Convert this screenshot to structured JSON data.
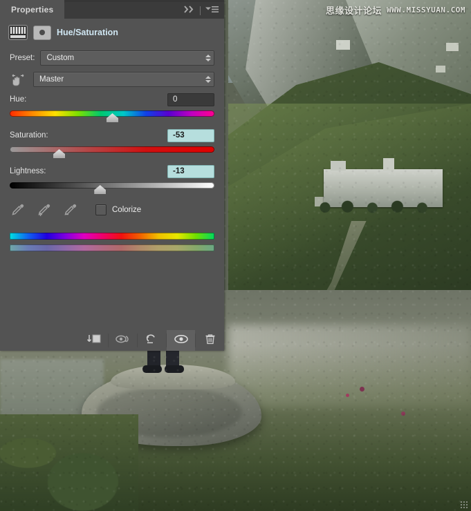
{
  "panel": {
    "tab_label": "Properties",
    "collapse_icon": "double-chevron-right-icon",
    "menu_icon": "panel-menu-icon",
    "title": "Hue/Saturation",
    "adjustment_thumb_icon": "hue-saturation-adjustment-icon",
    "mask_thumb_icon": "layer-mask-icon",
    "preset": {
      "label": "Preset:",
      "value": "Custom"
    },
    "channel": {
      "hand_icon": "targeted-adjustment-hand-icon",
      "value": "Master"
    },
    "sliders": [
      {
        "label": "Hue:",
        "value": "0",
        "handle_pct": 50,
        "highlighted": false
      },
      {
        "label": "Saturation:",
        "value": "-53",
        "handle_pct": 24,
        "highlighted": true
      },
      {
        "label": "Lightness:",
        "value": "-13",
        "handle_pct": 44,
        "highlighted": true
      }
    ],
    "tools": {
      "eyedropper_icon": "eyedropper-icon",
      "eyedropper_add_icon": "eyedropper-add-icon",
      "eyedropper_subtract_icon": "eyedropper-subtract-icon",
      "colorize_label": "Colorize",
      "colorize_checked": false
    },
    "ramps": {
      "top_name": "color-range-ramp-top",
      "bottom_name": "color-range-ramp-bottom"
    },
    "footer_buttons": [
      {
        "name": "clip-to-layer-button",
        "icon": "clip-to-layer-icon",
        "active": false
      },
      {
        "name": "view-previous-state-button",
        "icon": "previous-state-eye-icon",
        "active": false
      },
      {
        "name": "reset-adjustment-button",
        "icon": "reset-arrow-icon",
        "active": false
      },
      {
        "name": "toggle-layer-visibility-button",
        "icon": "eye-icon",
        "active": true
      },
      {
        "name": "delete-adjustment-layer-button",
        "icon": "trash-icon",
        "active": false
      }
    ]
  },
  "watermark": {
    "chinese": "思缘设计论坛",
    "url": "WWW.MISSYUAN.COM"
  },
  "colors": {
    "panel_bg": "#535353",
    "tabbar_bg": "#363636",
    "title_text": "#cfe6f2",
    "highlight_field": "#b6dedd",
    "dark_field": "#3a3a3a"
  }
}
